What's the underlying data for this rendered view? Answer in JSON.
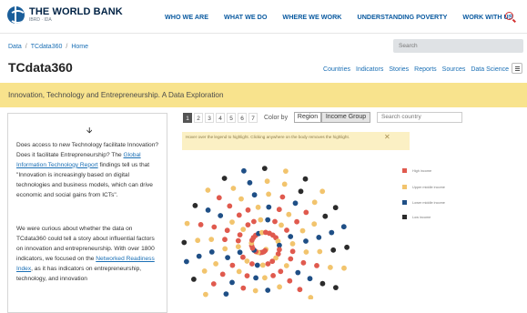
{
  "header": {
    "logo_title": "THE WORLD BANK",
    "logo_sub": "IBRD · IDA",
    "nav": [
      "WHO WE ARE",
      "WHAT WE DO",
      "WHERE WE WORK",
      "UNDERSTANDING POVERTY",
      "WORK WITH US"
    ]
  },
  "breadcrumb": [
    "Data",
    "TCdata360",
    "Home"
  ],
  "search": {
    "placeholder": "Search"
  },
  "site": {
    "title": "TCdata360",
    "nav": [
      "Countries",
      "Indicators",
      "Stories",
      "Reports",
      "Sources",
      "Data Science"
    ]
  },
  "banner": {
    "text": "Innovation, Technology and Entrepreneurship. A Data Exploration"
  },
  "story": {
    "p1_q": "Does access to new Technology facilitate Innovation? Does it facilitate Entrepreneurship? The ",
    "p1_link": "Global Information Technology Report",
    "p1_rest": " findings tell us that \"Innovation is increasingly based on digital technologies and business models, which can drive economic and social gains from ICTs\".",
    "p2_a": "We were curious about whether the data on TCdata360 could tell a story about influential factors on innovation and entrepreneurship. With over 1800 indicators, we focused on the ",
    "p2_link": "Networked Readiness Index",
    "p2_b": ", as it has indicators on entrepreneurship, technology, and innovation"
  },
  "controls": {
    "pages": [
      "1",
      "2",
      "3",
      "4",
      "5",
      "6",
      "7"
    ],
    "active_page": "1",
    "color_by_label": "Color by",
    "color_options": [
      "Region",
      "Income Group"
    ],
    "selected_color_option": "Income Group",
    "country_search_placeholder": "Search country"
  },
  "hint": {
    "text": "Hover over the legend to highlight. Clicking anywhere on the body removes the highlight.",
    "close": "✕"
  },
  "legend": {
    "items": [
      {
        "label": "High income",
        "color": "#e05a4e"
      },
      {
        "label": "Upper middle income",
        "color": "#f2c46d"
      },
      {
        "label": "Lower middle income",
        "color": "#1f4f86"
      },
      {
        "label": "Low income",
        "color": "#2b2b2b"
      }
    ]
  },
  "colors": {
    "accent_blue": "#1a6fb5",
    "banner_bg": "#f8e38d",
    "high_income": "#e05a4e",
    "upper_middle": "#f2c46d",
    "lower_middle": "#1f4f86",
    "low_income": "#2b2b2b"
  }
}
